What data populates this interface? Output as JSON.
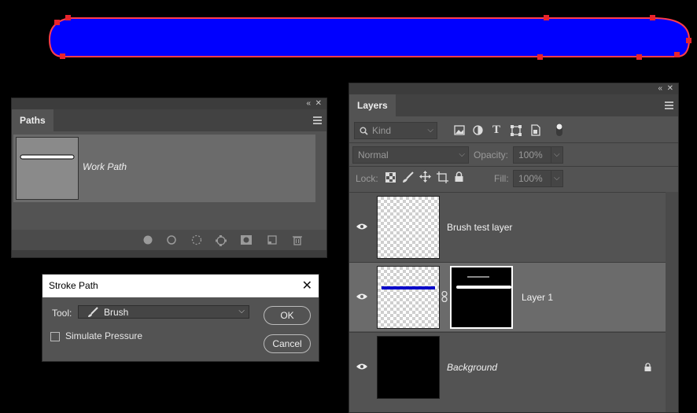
{
  "colors": {
    "path_fill": "#0000ff",
    "path_stroke": "#ff3d4d",
    "anchor": "#e8242c",
    "panel_bg": "#535353",
    "selected_row": "#6b6b6b"
  },
  "paths_panel": {
    "tab_label": "Paths",
    "items": [
      {
        "name": "Work Path"
      }
    ],
    "footer_icons": [
      "fill-path-icon",
      "stroke-path-icon",
      "load-selection-icon",
      "make-path-icon",
      "add-mask-icon",
      "new-path-icon",
      "trash-icon"
    ]
  },
  "stroke_dialog": {
    "title": "Stroke Path",
    "tool_label": "Tool:",
    "tool_value": "Brush",
    "simulate_label": "Simulate Pressure",
    "simulate_checked": false,
    "ok_label": "OK",
    "cancel_label": "Cancel"
  },
  "layers_panel": {
    "tab_label": "Layers",
    "filter_placeholder": "Kind",
    "blend_mode": "Normal",
    "opacity_label": "Opacity:",
    "opacity_value": "100%",
    "lock_label": "Lock:",
    "fill_label": "Fill:",
    "fill_value": "100%",
    "layers": [
      {
        "name": "Brush test layer",
        "visible": true,
        "selected": false
      },
      {
        "name": "Layer 1",
        "visible": true,
        "selected": true
      },
      {
        "name": "Background",
        "visible": true,
        "selected": false,
        "locked": true
      }
    ]
  }
}
